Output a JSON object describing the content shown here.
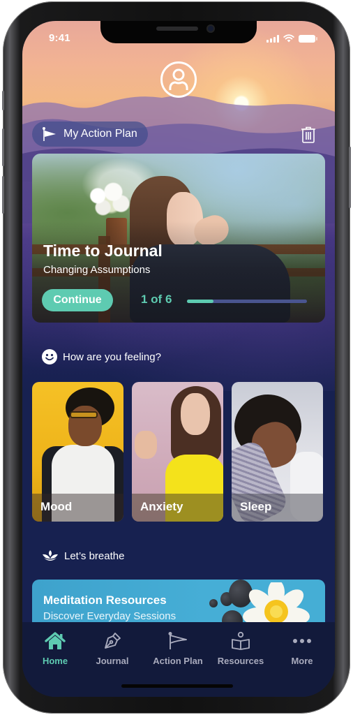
{
  "status_bar": {
    "time": "9:41"
  },
  "header": {
    "profile_icon": "user-circle-icon",
    "action_plan_label": "My Action Plan",
    "action_plan_icon": "flag-icon",
    "delete_icon": "trash-icon"
  },
  "journal_card": {
    "title": "Time to Journal",
    "subtitle": "Changing Assumptions",
    "button_label": "Continue",
    "progress_text": "1 of 6",
    "progress_current": 1,
    "progress_total": 6,
    "progress_fraction": 0.22
  },
  "feelings": {
    "heading": "How are you feeling?",
    "icon": "smiley-icon",
    "cards": [
      {
        "label": "Mood"
      },
      {
        "label": "Anxiety"
      },
      {
        "label": "Sleep"
      }
    ]
  },
  "breathe": {
    "heading": "Let’s breathe",
    "icon": "lotus-icon",
    "card": {
      "title": "Meditation Resources",
      "subtitle": "Discover Everyday Sessions"
    }
  },
  "tabbar": {
    "items": [
      {
        "label": "Home",
        "icon": "home-icon",
        "active": true
      },
      {
        "label": "Journal",
        "icon": "pen-nib-icon",
        "active": false
      },
      {
        "label": "Action Plan",
        "icon": "flag-icon",
        "active": false
      },
      {
        "label": "Resources",
        "icon": "book-reader-icon",
        "active": false
      },
      {
        "label": "More",
        "icon": "more-dots-icon",
        "active": false
      }
    ]
  },
  "colors": {
    "accent": "#5ecbb1",
    "background": "#172150",
    "tabbar": "#121a3b",
    "inactive_tab": "#a9abbd",
    "progress_track": "#4a5590"
  }
}
